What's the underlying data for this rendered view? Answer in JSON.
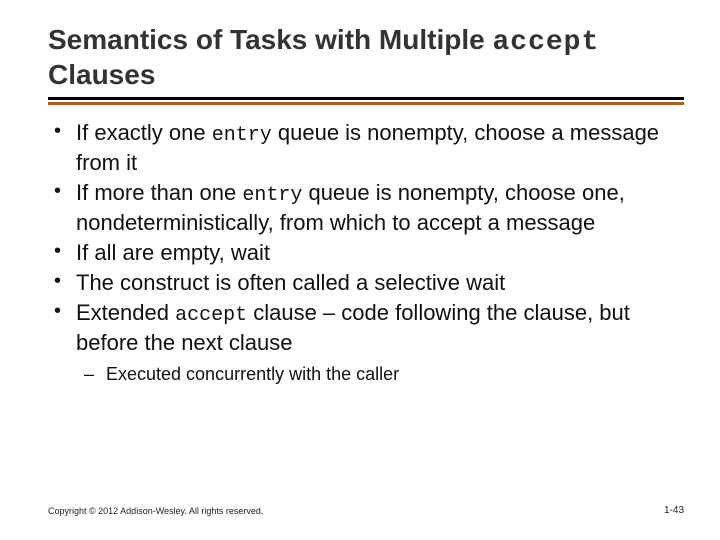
{
  "title": {
    "pre": "Semantics of Tasks with Multiple ",
    "mono": "accept",
    "post": " Clauses"
  },
  "bullets": [
    {
      "segments": [
        {
          "t": "If exactly one "
        },
        {
          "t": "entry",
          "mono": true
        },
        {
          "t": " queue is nonempty, choose a message from it"
        }
      ]
    },
    {
      "segments": [
        {
          "t": "If more than one "
        },
        {
          "t": "entry",
          "mono": true
        },
        {
          "t": " queue is nonempty, choose one, nondeterministically, from which to accept a message"
        }
      ]
    },
    {
      "segments": [
        {
          "t": "If all are empty, wait"
        }
      ]
    },
    {
      "segments": [
        {
          "t": "The construct is often called a selective wait"
        }
      ]
    },
    {
      "segments": [
        {
          "t": "Extended "
        },
        {
          "t": "accept",
          "mono": true
        },
        {
          "t": " clause – code following the clause, but before the next clause"
        }
      ],
      "sub": [
        "Executed concurrently with the caller"
      ]
    }
  ],
  "footer": "Copyright © 2012 Addison-Wesley. All rights reserved.",
  "pagenum": "1-43"
}
